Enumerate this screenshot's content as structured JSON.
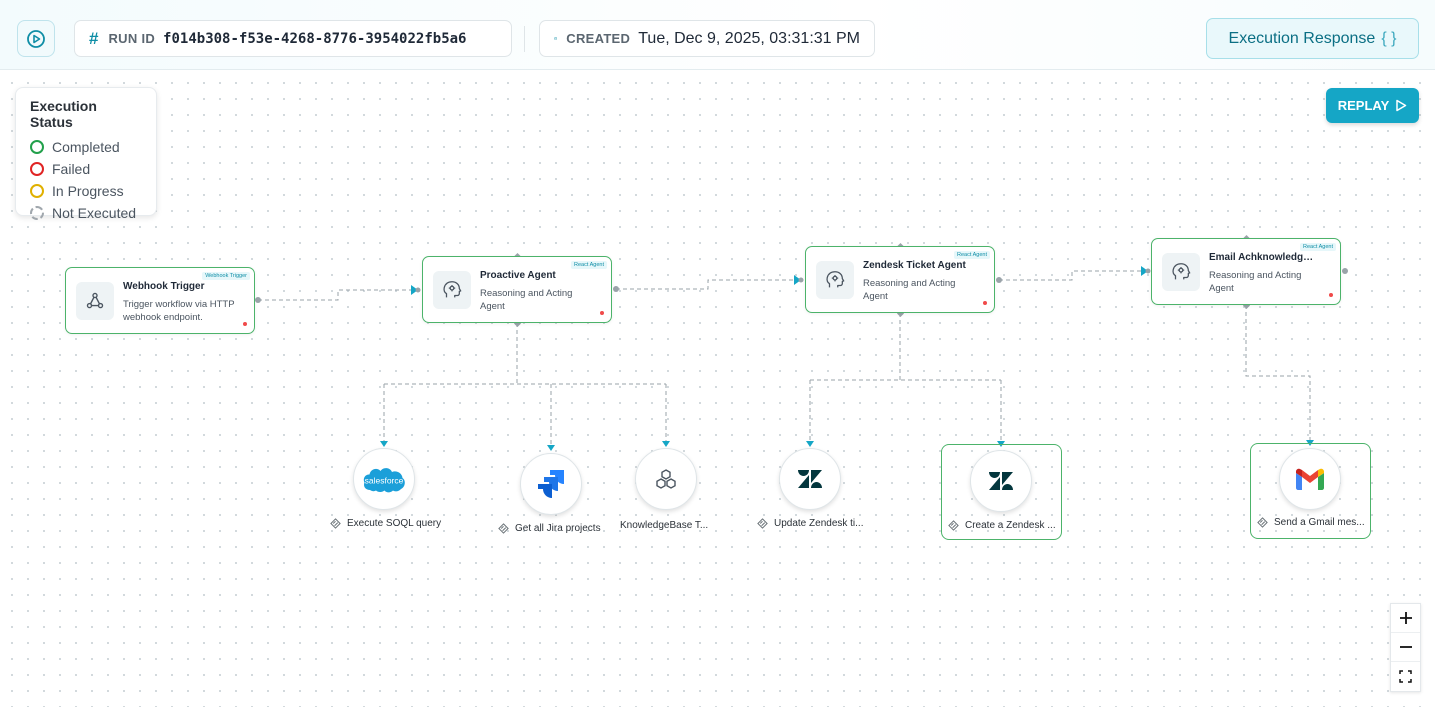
{
  "header": {
    "run_id_label": "RUN ID",
    "run_id_value": "f014b308-f53e-4268-8776-3954022fb5a6",
    "created_label": "CREATED",
    "created_value": "Tue, Dec 9, 2025, 03:31:31 PM",
    "execution_response_label": "Execution Response",
    "execution_response_braces": "{ }"
  },
  "status_legend": {
    "title": "Execution Status",
    "items": [
      "Completed",
      "Failed",
      "In Progress",
      "Not Executed"
    ]
  },
  "replay_label": "REPLAY",
  "nodes": [
    {
      "title": "Webhook Trigger",
      "badge": "Webhook Trigger",
      "desc": "Trigger workflow via HTTP webhook endpoint.",
      "icon": "webhook-icon"
    },
    {
      "title": "Proactive Agent",
      "badge": "React Agent",
      "desc": "Reasoning and Acting Agent",
      "icon": "agent-head-icon"
    },
    {
      "title": "Zendesk Ticket Agent",
      "badge": "React Agent",
      "desc": "Reasoning and Acting Agent",
      "icon": "agent-head-icon"
    },
    {
      "title": "Email Achknowledge...",
      "badge": "React Agent",
      "desc": "Reasoning and Acting Agent",
      "icon": "agent-head-icon"
    }
  ],
  "tools": [
    {
      "label": "Execute SOQL query",
      "icon": "salesforce-icon",
      "logo_text": "salesforce"
    },
    {
      "label": "Get all Jira projects",
      "icon": "jira-icon"
    },
    {
      "label": "KnowledgeBase T...",
      "icon": "knowledgebase-icon"
    },
    {
      "label": "Update Zendesk ti...",
      "icon": "zendesk-icon"
    },
    {
      "label": "Create a Zendesk ...",
      "icon": "zendesk-icon"
    },
    {
      "label": "Send a Gmail mes...",
      "icon": "gmail-icon"
    }
  ],
  "colors": {
    "accent": "#15a6c6",
    "completed": "#22a04b",
    "failed": "#e02424",
    "in_progress": "#e0b000",
    "not_executed": "#a0a7ad"
  },
  "zoom_controls": [
    "+",
    "−",
    "fit"
  ]
}
